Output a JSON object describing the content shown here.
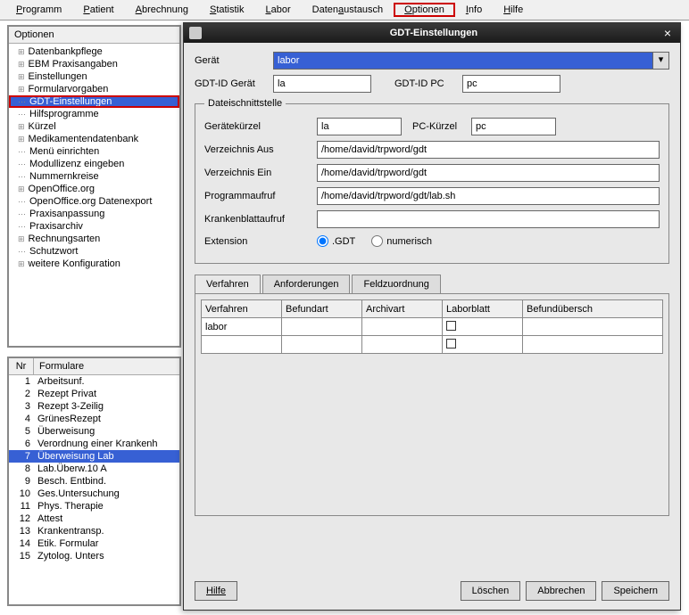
{
  "menubar": [
    {
      "label": "Programm",
      "m": 0
    },
    {
      "label": "Patient",
      "m": 0
    },
    {
      "label": "Abrechnung",
      "m": 0
    },
    {
      "label": "Statistik",
      "m": 0
    },
    {
      "label": "Labor",
      "m": 0
    },
    {
      "label": "Datenaustausch",
      "m": 5
    },
    {
      "label": "Optionen",
      "m": 0,
      "hl": true
    },
    {
      "label": "Info",
      "m": 0
    },
    {
      "label": "Hilfe",
      "m": 0
    }
  ],
  "tree": {
    "header": "Optionen",
    "items": [
      {
        "label": "Datenbankpflege",
        "exp": true
      },
      {
        "label": "EBM Praxisangaben",
        "exp": true
      },
      {
        "label": "Einstellungen",
        "exp": true
      },
      {
        "label": "Formularvorgaben",
        "exp": true
      },
      {
        "label": "GDT-Einstellungen",
        "sel": true,
        "hl": true
      },
      {
        "label": "Hilfsprogramme"
      },
      {
        "label": "Kürzel",
        "exp": true
      },
      {
        "label": "Medikamentendatenbank",
        "exp": true
      },
      {
        "label": "Menü einrichten"
      },
      {
        "label": "Modullizenz eingeben"
      },
      {
        "label": "Nummernkreise"
      },
      {
        "label": "OpenOffice.org",
        "exp": true
      },
      {
        "label": "OpenOffice.org Datenexport"
      },
      {
        "label": "Praxisanpassung"
      },
      {
        "label": "Praxisarchiv"
      },
      {
        "label": "Rechnungsarten",
        "exp": true
      },
      {
        "label": "Schutzwort"
      },
      {
        "label": "weitere Konfiguration",
        "exp": true
      }
    ]
  },
  "forms": {
    "header_nr": "Nr",
    "header_name": "Formulare",
    "rows": [
      {
        "nr": "1",
        "name": "Arbeitsunf."
      },
      {
        "nr": "2",
        "name": "Rezept Privat"
      },
      {
        "nr": "3",
        "name": "Rezept 3-Zeilig"
      },
      {
        "nr": "4",
        "name": "GrünesRezept"
      },
      {
        "nr": "5",
        "name": "Überweisung"
      },
      {
        "nr": "6",
        "name": "Verordnung einer Krankenh"
      },
      {
        "nr": "7",
        "name": "Überweisung Lab",
        "sel": true
      },
      {
        "nr": "8",
        "name": "Lab.Überw.10 A"
      },
      {
        "nr": "9",
        "name": "Besch. Entbind."
      },
      {
        "nr": "10",
        "name": "Ges.Untersuchung"
      },
      {
        "nr": "11",
        "name": "Phys. Therapie"
      },
      {
        "nr": "12",
        "name": "Attest"
      },
      {
        "nr": "13",
        "name": "Krankentransp."
      },
      {
        "nr": "14",
        "name": "Etik. Formular"
      },
      {
        "nr": "15",
        "name": "Zytolog. Unters"
      }
    ]
  },
  "dialog": {
    "title": "GDT-Einstellungen",
    "geraet_label": "Gerät",
    "geraet_value": "labor",
    "gdtid_geraet_label": "GDT-ID Gerät",
    "gdtid_geraet_value": "la",
    "gdtid_pc_label": "GDT-ID PC",
    "gdtid_pc_value": "pc",
    "fs_legend": "Dateischnittstelle",
    "gk_label": "Gerätekürzel",
    "gk_value": "la",
    "pck_label": "PC-Kürzel",
    "pck_value": "pc",
    "va_label": "Verzeichnis Aus",
    "va_value": "/home/david/trpword/gdt",
    "ve_label": "Verzeichnis Ein",
    "ve_value": "/home/david/trpword/gdt",
    "pa_label": "Programmaufruf",
    "pa_value": "/home/david/trpword/gdt/lab.sh",
    "kb_label": "Krankenblattaufruf",
    "kb_value": "",
    "ext_label": "Extension",
    "ext_opt1": ".GDT",
    "ext_opt2": "numerisch",
    "tabs": [
      "Verfahren",
      "Anforderungen",
      "Feldzuordnung"
    ],
    "grid_headers": [
      "Verfahren",
      "Befundart",
      "Archivart",
      "Laborblatt",
      "Befundübersch"
    ],
    "grid_row0": "labor",
    "btn_help": "Hilfe",
    "btn_del": "Löschen",
    "btn_cancel": "Abbrechen",
    "btn_save": "Speichern"
  }
}
